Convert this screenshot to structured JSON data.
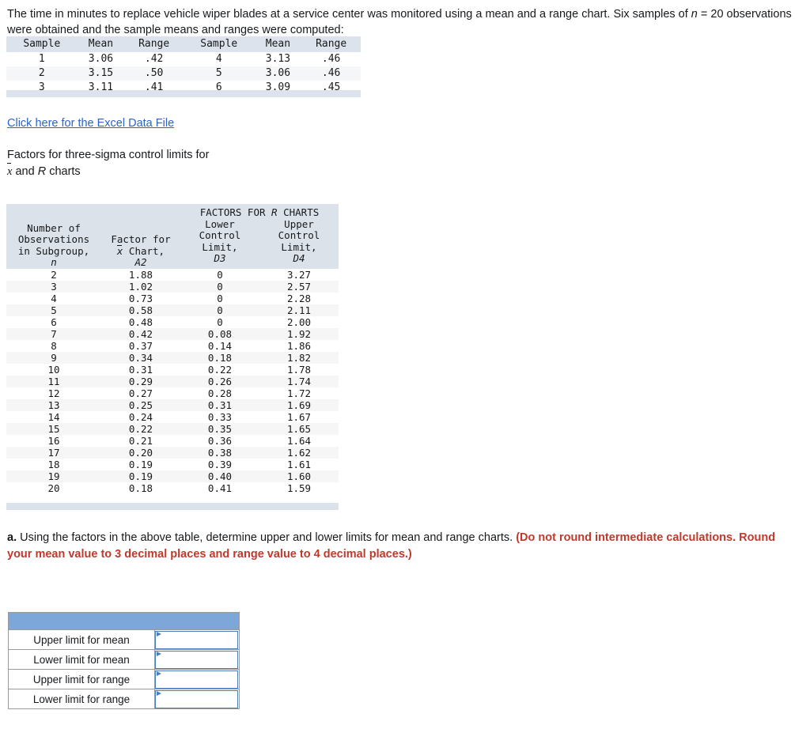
{
  "intro": {
    "line1_pre": "The time in minutes to replace vehicle wiper blades at a service center was monitored using a mean and a range chart. Six samples of ",
    "n_symbol": "n",
    "line2_post": " = 20 observations were obtained and the sample means and ranges were computed:"
  },
  "samples_table": {
    "headers": [
      "Sample",
      "Mean",
      "Range",
      "Sample",
      "Mean",
      "Range"
    ],
    "rows": [
      [
        "1",
        "3.06",
        ".42",
        "4",
        "3.13",
        ".46"
      ],
      [
        "2",
        "3.15",
        ".50",
        "5",
        "3.06",
        ".46"
      ],
      [
        "3",
        "3.11",
        ".41",
        "6",
        "3.09",
        ".45"
      ]
    ]
  },
  "excel_link": {
    "label": "Click here for the Excel Data File"
  },
  "factors_caption": {
    "line1": "Factors for three-sigma control limits for",
    "xbar_symbol": "x",
    "and_text": " and ",
    "r_symbol": "R",
    "charts_text": " charts"
  },
  "factors_table": {
    "span_header": "FACTORS FOR ",
    "span_header_italic": "R",
    "span_header_post": " CHARTS",
    "col1_header_lines": [
      "Number of",
      "Observations",
      "in Subgroup,"
    ],
    "col1_header_italic": "n",
    "col2_header_line1": "Factor for",
    "col2_header_xbar": "x",
    "col2_header_line2_post": " Chart,",
    "col2_header_italic": "A2",
    "col3_header_lines": [
      "Lower",
      "Control",
      "Limit,"
    ],
    "col3_header_italic": "D3",
    "col4_header_lines": [
      "Upper",
      "Control",
      "Limit,"
    ],
    "col4_header_italic": "D4",
    "rows": [
      [
        "2",
        "1.88",
        "0",
        "3.27"
      ],
      [
        "3",
        "1.02",
        "0",
        "2.57"
      ],
      [
        "4",
        "0.73",
        "0",
        "2.28"
      ],
      [
        "5",
        "0.58",
        "0",
        "2.11"
      ],
      [
        "6",
        "0.48",
        "0",
        "2.00"
      ],
      [
        "7",
        "0.42",
        "0.08",
        "1.92"
      ],
      [
        "8",
        "0.37",
        "0.14",
        "1.86"
      ],
      [
        "9",
        "0.34",
        "0.18",
        "1.82"
      ],
      [
        "10",
        "0.31",
        "0.22",
        "1.78"
      ],
      [
        "11",
        "0.29",
        "0.26",
        "1.74"
      ],
      [
        "12",
        "0.27",
        "0.28",
        "1.72"
      ],
      [
        "13",
        "0.25",
        "0.31",
        "1.69"
      ],
      [
        "14",
        "0.24",
        "0.33",
        "1.67"
      ],
      [
        "15",
        "0.22",
        "0.35",
        "1.65"
      ],
      [
        "16",
        "0.21",
        "0.36",
        "1.64"
      ],
      [
        "17",
        "0.20",
        "0.38",
        "1.62"
      ],
      [
        "18",
        "0.19",
        "0.39",
        "1.61"
      ],
      [
        "19",
        "0.19",
        "0.40",
        "1.60"
      ],
      [
        "20",
        "0.18",
        "0.41",
        "1.59"
      ]
    ]
  },
  "question_a": {
    "label": "a.",
    "text": " Using the factors in the above table, determine upper and lower limits for mean and range charts. ",
    "note": "(Do not round intermediate calculations. Round your mean value to 3 decimal places and range value to 4 decimal places.)"
  },
  "answer_table": {
    "header_label": "",
    "rows": [
      {
        "label": "Upper limit for mean",
        "value": ""
      },
      {
        "label": "Lower limit for mean",
        "value": ""
      },
      {
        "label": "Upper limit for range",
        "value": ""
      },
      {
        "label": "Lower limit for range",
        "value": ""
      }
    ]
  },
  "colors": {
    "link": "#2d63c8",
    "note_red": "#c0392b",
    "table_header_blue_gray": "#dde3ec",
    "answer_header_blue": "#7da7d9",
    "input_border_blue": "#4a7dba"
  }
}
